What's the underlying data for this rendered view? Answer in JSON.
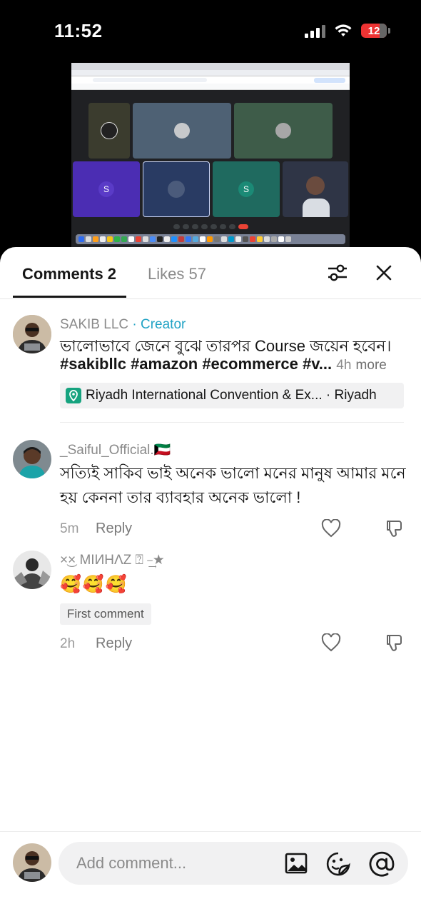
{
  "status": {
    "time": "11:52",
    "battery": "12"
  },
  "tabs": {
    "comments": "Comments 2",
    "likes": "Likes 57"
  },
  "post": {
    "author": "SAKIB LLC",
    "creator_label": "· Creator",
    "line1": "ভালোভাবে জেনে বুঝে তারপর Course জয়েন হবেন।",
    "hashtags": "#sakibllc #amazon #ecommerce #v...",
    "age": "4h",
    "more": "more",
    "location": "Riyadh International Convention & Ex... · Riyadh"
  },
  "comments": [
    {
      "author": "_Saiful_Official.🇰🇼",
      "line1": "সত্যিই সাকিব ভাই অনেক ভালো মনের মানুষ আমার মনে",
      "line2": "হয় কেননা তার ব্যাবহার অনেক ভালো !",
      "age": "5m",
      "reply": "Reply"
    },
    {
      "author": "×͜× MIИHΛZ ⍰ ⎯͢★",
      "text": "🥰🥰🥰",
      "badge": "First comment",
      "age": "2h",
      "reply": "Reply"
    }
  ],
  "input": {
    "placeholder": "Add comment..."
  },
  "colors": {
    "creator": "#22a3c5",
    "location_pin": "#16a37f",
    "battery": "#e33333"
  }
}
